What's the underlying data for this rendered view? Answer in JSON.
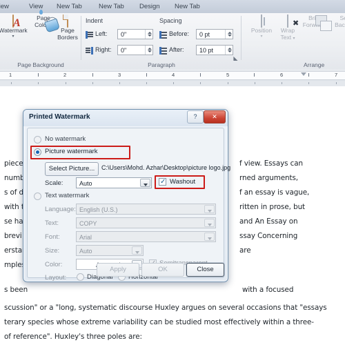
{
  "ribbon": {
    "tabs": [
      {
        "label": "view",
        "active": false
      },
      {
        "label": "View",
        "active": false
      },
      {
        "label": "New Tab",
        "active": false
      },
      {
        "label": "New Tab",
        "active": false
      },
      {
        "label": "Design",
        "active": false
      },
      {
        "label": "New Tab",
        "active": false
      }
    ],
    "groups": [
      {
        "name": "Page Background"
      },
      {
        "name": "Paragraph"
      },
      {
        "name": "Arrange"
      }
    ],
    "page_background": {
      "watermark_label": "Watermark",
      "page_color_label_1": "Page",
      "page_color_label_2": "Color",
      "page_borders_label_1": "Page",
      "page_borders_label_2": "Borders",
      "watermark_letter": "A"
    },
    "paragraph": {
      "indent_header": "Indent",
      "spacing_header": "Spacing",
      "left_label": "Left:",
      "left_value": "0\"",
      "right_label": "Right:",
      "right_value": "0\"",
      "before_label": "Before:",
      "before_value": "0 pt",
      "after_label": "After:",
      "after_value": "10 pt"
    },
    "arrange": {
      "position_label": "Position",
      "wrap_label_1": "Wrap",
      "wrap_label_2": "Text",
      "bring_label_1": "Bring",
      "bring_label_2": "Forward",
      "send_label_1": "Sen",
      "send_label_2": "Backwa"
    }
  },
  "ruler": {
    "numbers": [
      "1",
      "2",
      "3",
      "4",
      "5",
      "6",
      "7"
    ]
  },
  "document": {
    "paragraph_fragments_left": [
      "piece",
      "numb",
      "s of da",
      "with t",
      "se hav",
      "brevi",
      "erstan",
      "mples."
    ],
    "paragraph_fragments_right": [
      "f view. Essays can",
      "rned arguments,",
      "f an essay is vague,",
      "ritten in prose, but",
      "and An Essay on",
      "ssay Concerning",
      "are"
    ],
    "lower_lines": [
      "s been",
      "with a focused",
      "scussion\" or a \"long, systematic discourse Huxley argues on several occasions that \"essays",
      "terary species whose extreme variability can be studied most effectively within a three-",
      "of reference\". Huxley's three poles are:"
    ]
  },
  "dialog": {
    "title": "Printed Watermark",
    "help_glyph": "?",
    "close_glyph": "✕",
    "options": {
      "no_watermark": "No watermark",
      "picture_watermark": "Picture watermark",
      "text_watermark": "Text watermark"
    },
    "selected_option": "picture_watermark",
    "picture": {
      "select_button": "Select Picture...",
      "path": "C:\\Users\\Mohd. Azhar\\Desktop\\picture logo.jpg",
      "scale_label": "Scale:",
      "scale_value": "Auto",
      "washout_label": "Washout",
      "washout_checked": true
    },
    "text": {
      "language_label": "Language:",
      "language_value": "English (U.S.)",
      "text_label": "Text:",
      "text_value": "COPY",
      "font_label": "Font:",
      "font_value": "Arial",
      "size_label": "Size:",
      "size_value": "Auto",
      "color_label": "Color:",
      "color_value": "Automatic",
      "semitransparent_label": "Semitransparent",
      "semitransparent_checked": true,
      "layout_label": "Layout:",
      "layout_diagonal": "Diagonal",
      "layout_horizontal": "Horizontal",
      "layout_selected": "Diagonal"
    },
    "buttons": {
      "apply": "Apply",
      "ok": "OK",
      "close": "Close"
    }
  },
  "colors": {
    "highlight": "#cc1b18",
    "accent": "#1565b5",
    "close_red": "#cc4535"
  }
}
